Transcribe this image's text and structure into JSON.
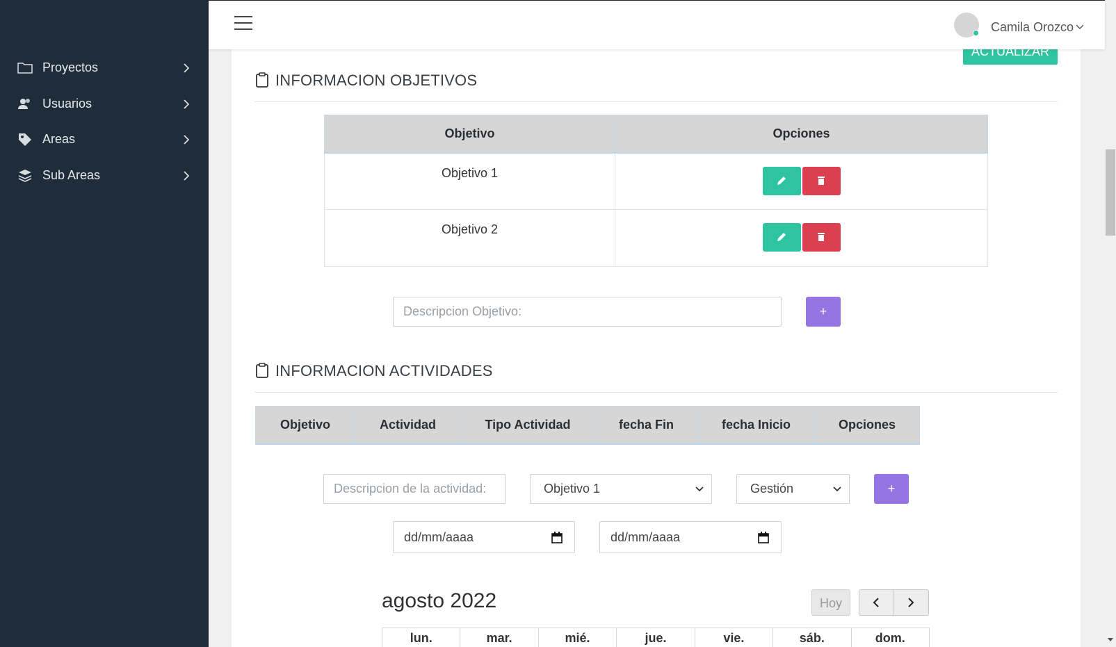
{
  "user": {
    "name": "Camila Orozco"
  },
  "sidebar": {
    "items": [
      {
        "label": "Proyectos",
        "icon": "folder-icon"
      },
      {
        "label": "Usuarios",
        "icon": "users-icon"
      },
      {
        "label": "Areas",
        "icon": "tag-icon"
      },
      {
        "label": "Sub Areas",
        "icon": "layers-icon"
      }
    ]
  },
  "toolbar": {
    "update_label": "ACTUALIZAR"
  },
  "objetivos": {
    "title": "INFORMACION OBJETIVOS",
    "columns": [
      "Objetivo",
      "Opciones"
    ],
    "rows": [
      {
        "objetivo": "Objetivo 1"
      },
      {
        "objetivo": "Objetivo 2"
      }
    ],
    "input_placeholder": "Descripcion Objetivo:",
    "add_label": "+"
  },
  "actividades": {
    "title": "INFORMACION ACTIVIDADES",
    "columns": [
      "Objetivo",
      "Actividad",
      "Tipo Actividad",
      "fecha Fin",
      "fecha Inicio",
      "Opciones"
    ],
    "input_placeholder": "Descripcion de la actividad:",
    "objetivo_selected": "Objetivo 1",
    "tipo_selected": "Gestión",
    "add_label": "+",
    "date_placeholder_1": "dd/mm/aaaa",
    "date_placeholder_2": "dd/mm/aaaa"
  },
  "calendar": {
    "title": "agosto 2022",
    "today_label": "Hoy",
    "days": [
      "lun.",
      "mar.",
      "mié.",
      "jue.",
      "vie.",
      "sáb.",
      "dom."
    ]
  },
  "colors": {
    "sidebar_bg": "#1f2d3a",
    "accent_green": "#2ec4a1",
    "danger_red": "#dc3f50",
    "purple": "#9575e4"
  }
}
